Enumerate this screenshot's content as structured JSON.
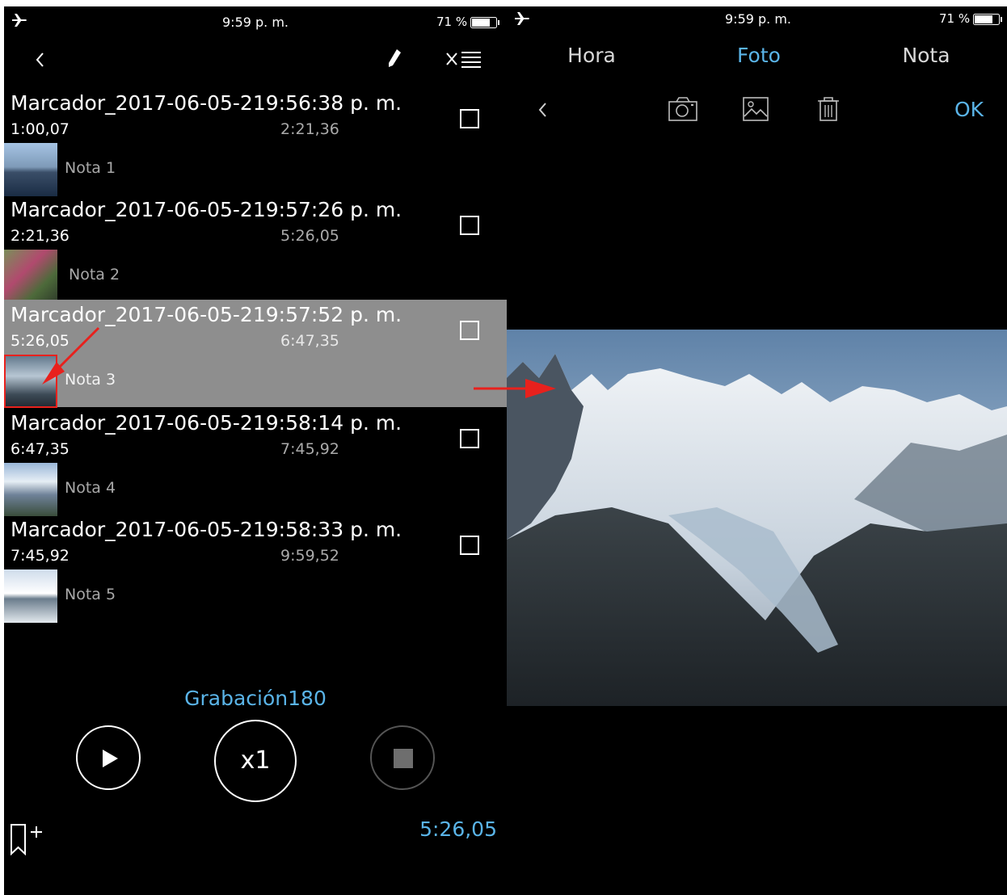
{
  "left": {
    "status": {
      "time": "9:59 p. m.",
      "battery": "71 %"
    },
    "header": {
      "back_icon": "chevron-left-icon",
      "edit_icon": "pencil-icon",
      "delete_list_icon": "x-list-icon"
    },
    "markers": [
      {
        "title": "Marcador_2017-06-05-219:56:38 p. m.",
        "start": "1:00,07",
        "end": "2:21,36",
        "note": "Nota 1",
        "selected": false
      },
      {
        "title": "Marcador_2017-06-05-219:57:26 p. m.",
        "start": "2:21,36",
        "end": "5:26,05",
        "note": "Nota 2",
        "selected": false
      },
      {
        "title": "Marcador_2017-06-05-219:57:52 p. m.",
        "start": "5:26,05",
        "end": "6:47,35",
        "note": "Nota 3",
        "selected": true
      },
      {
        "title": "Marcador_2017-06-05-219:58:14 p. m.",
        "start": "6:47,35",
        "end": "7:45,92",
        "note": "Nota 4",
        "selected": false
      },
      {
        "title": "Marcador_2017-06-05-219:58:33 p. m.",
        "start": "7:45,92",
        "end": "9:59,52",
        "note": "Nota 5",
        "selected": false
      }
    ],
    "player": {
      "recording_name": "Grabación180",
      "speed_label": "x1",
      "current_time": "5:26,05",
      "accent": "#5ab4e8"
    },
    "footer": {
      "add_bookmark_icon": "bookmark-plus-icon"
    }
  },
  "right": {
    "status": {
      "time": "9:59 p. m.",
      "battery": "71 %"
    },
    "tabs": [
      "Hora",
      "Foto",
      "Nota"
    ],
    "active_tab": "Foto",
    "toolbar": {
      "ok_label": "OK",
      "icons": [
        "chevron-left-icon",
        "camera-icon",
        "image-icon",
        "trash-icon"
      ]
    }
  },
  "annotations": {
    "color": "#e8211d"
  }
}
